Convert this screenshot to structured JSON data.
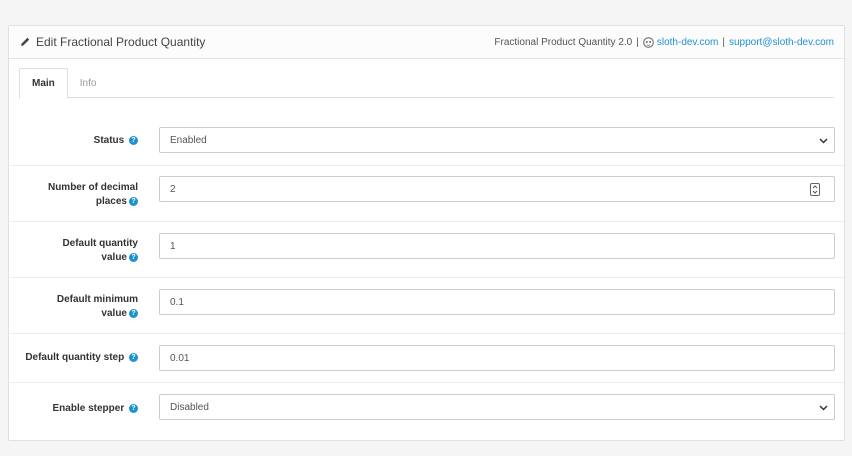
{
  "heading": {
    "title": "Edit Fractional Product Quantity",
    "module_version": "Fractional Product Quantity 2.0",
    "site_link": "sloth-dev.com",
    "support_link": "support@sloth-dev.com",
    "separator": "|"
  },
  "tabs": [
    {
      "label": "Main",
      "active": true
    },
    {
      "label": "Info",
      "active": false
    }
  ],
  "form": {
    "status": {
      "label": "Status",
      "value": "Enabled"
    },
    "decimal_places": {
      "label_line1": "Number of decimal",
      "label_line2": "places",
      "value": "2"
    },
    "default_quantity": {
      "label_line1": "Default quantity",
      "label_line2": "value",
      "value": "1"
    },
    "default_minimum": {
      "label_line1": "Default minimum",
      "label_line2": "value",
      "value": "0.1"
    },
    "quantity_step": {
      "label": "Default quantity step",
      "value": "0.01"
    },
    "enable_stepper": {
      "label": "Enable stepper",
      "value": "Disabled"
    }
  },
  "icons": {
    "title_icon": "pencil-icon",
    "site_icon": "sloth-icon",
    "help_icon": "question-circle-icon",
    "select_arrow": "chevron-down-icon",
    "stepper": "number-stepper-icon"
  },
  "colors": {
    "link": "#1e91cf",
    "help": "#1e91cf"
  }
}
